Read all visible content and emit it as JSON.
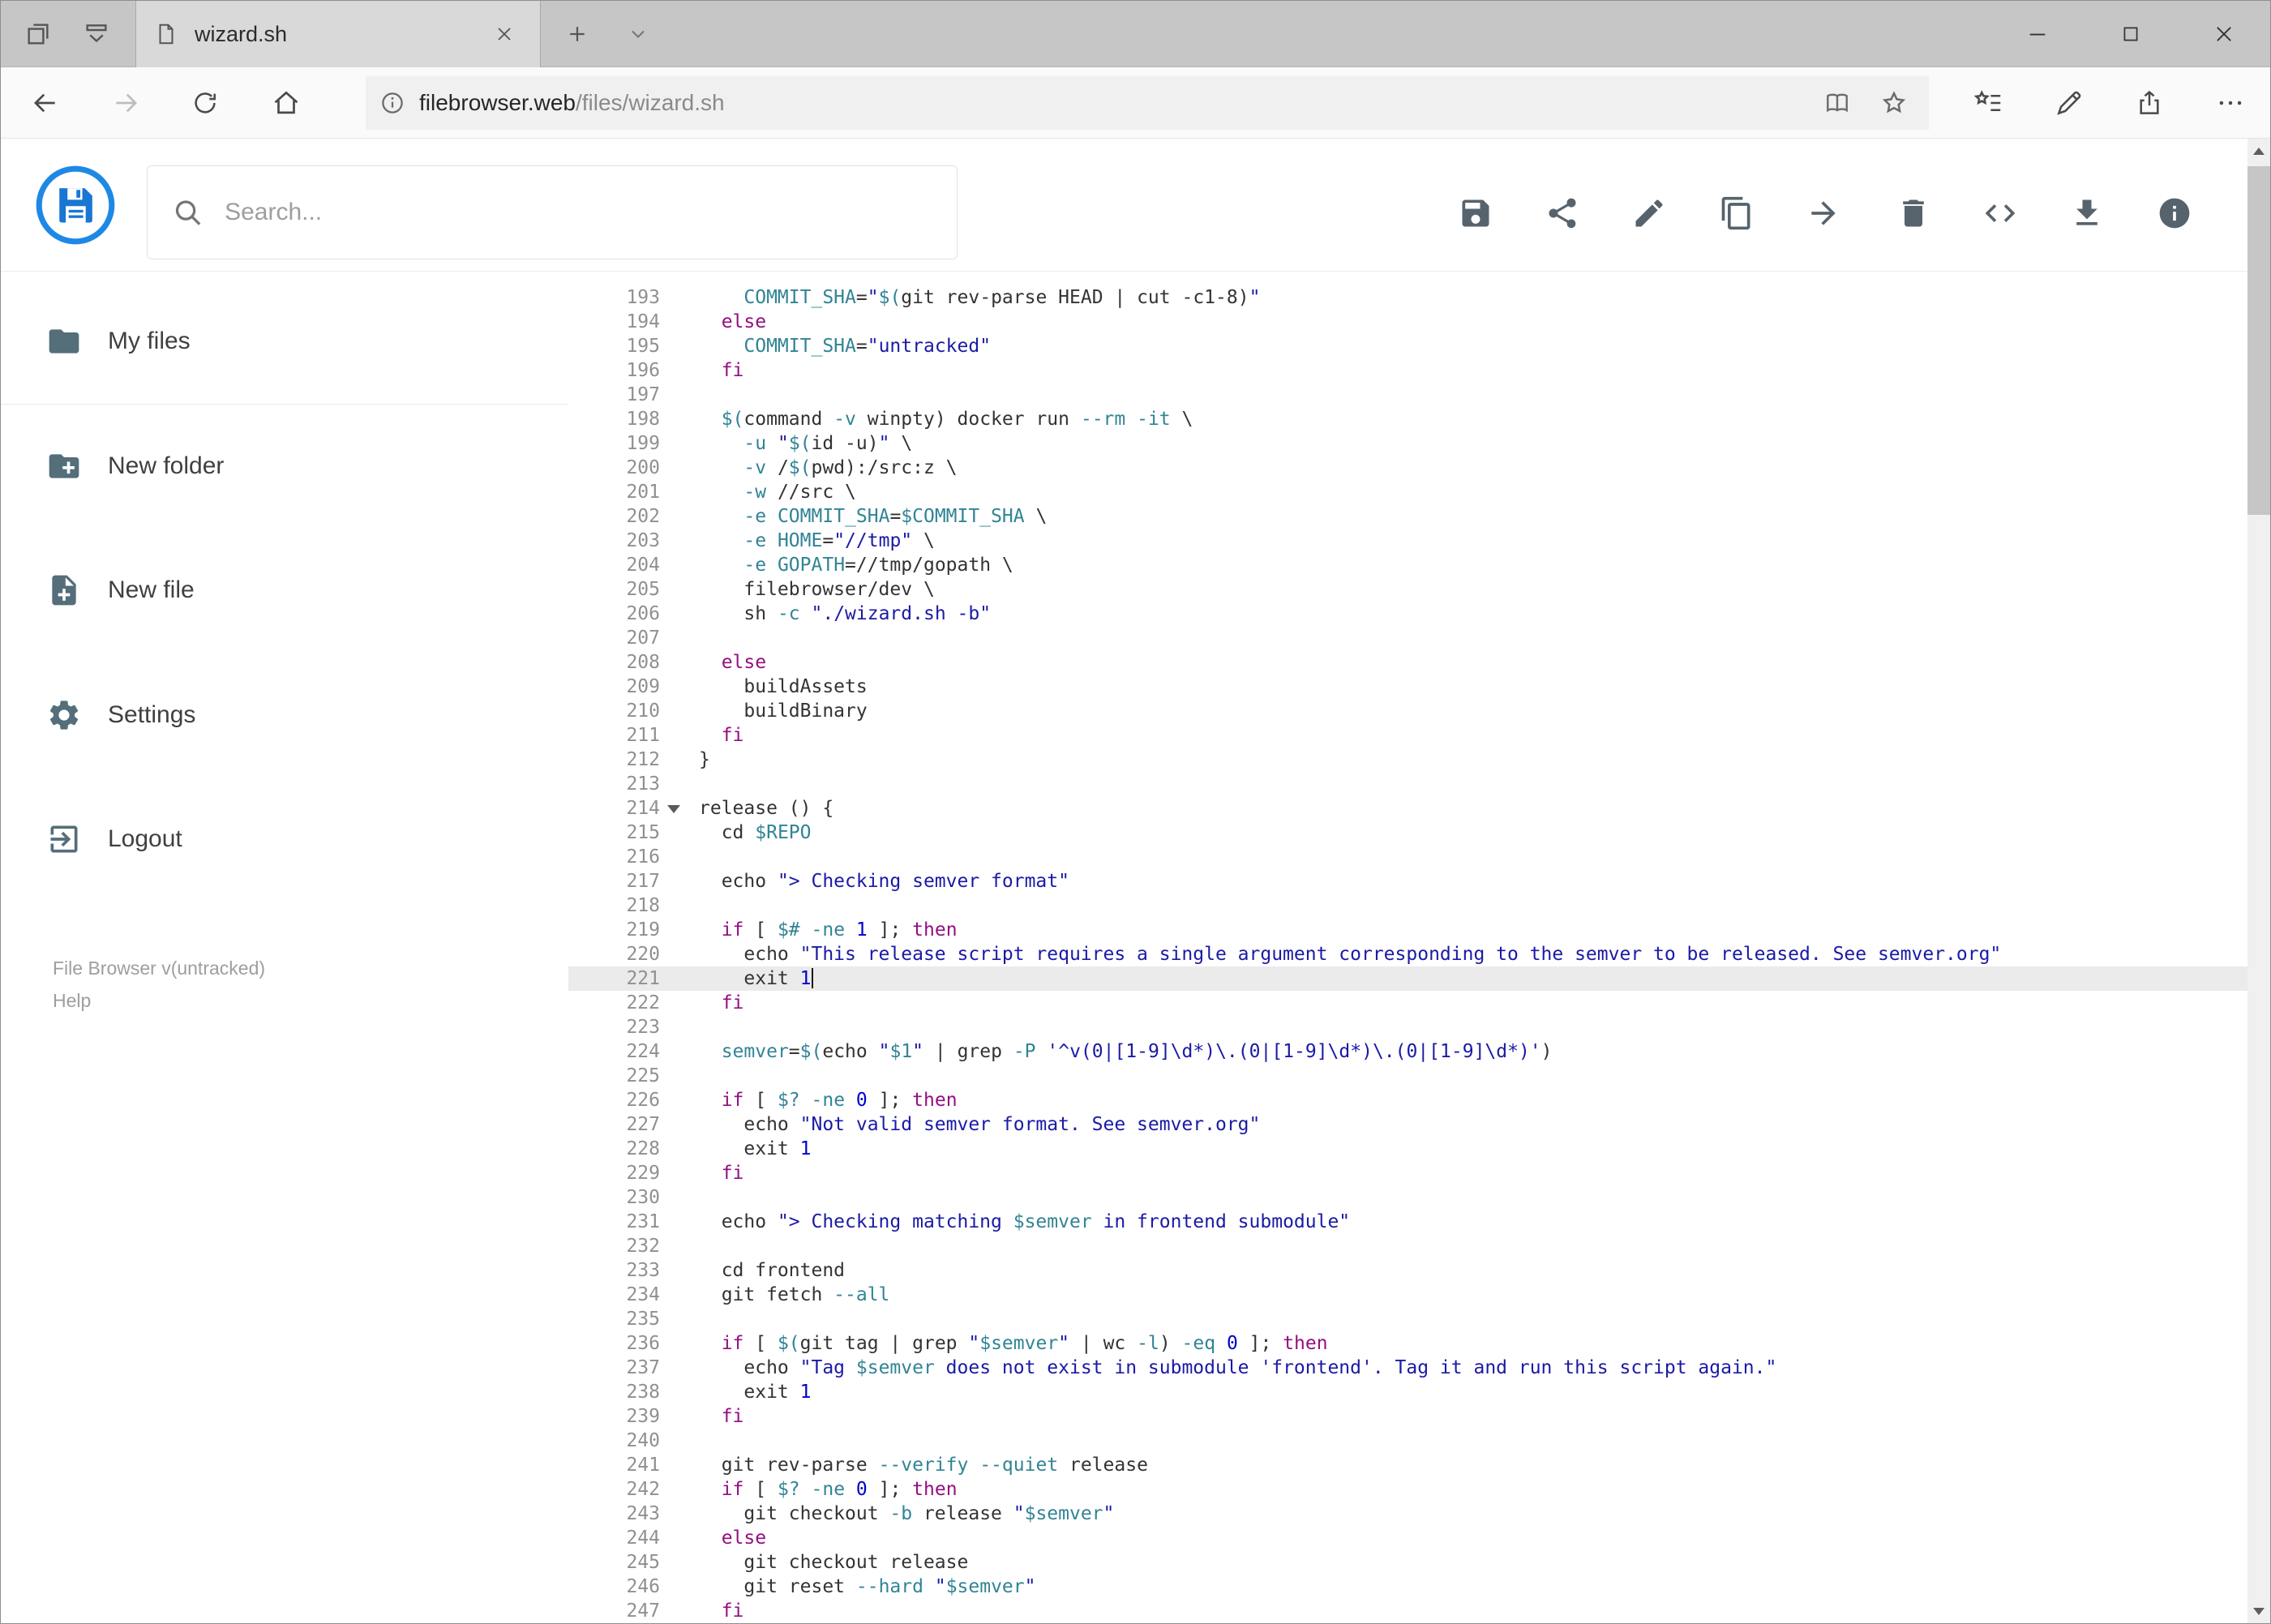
{
  "browser": {
    "tab_title": "wizard.sh",
    "url_domain": "filebrowser.web",
    "url_path": "/files/wizard.sh",
    "chrome_icons": [
      "set-tabs-aside-icon",
      "tab-preview-icon",
      "page-icon",
      "tab-close-icon",
      "new-tab-icon",
      "tab-list-chevron-icon",
      "minimize-icon",
      "maximize-icon",
      "close-icon",
      "back-icon",
      "forward-icon",
      "refresh-icon",
      "home-icon",
      "site-info-icon",
      "reading-view-icon",
      "favorite-star-icon",
      "hub-icon",
      "web-note-pen-icon",
      "share-icon",
      "ellipsis-icon"
    ]
  },
  "header": {
    "search_placeholder": "Search...",
    "action_icons": [
      "save",
      "share",
      "edit",
      "copy",
      "move",
      "delete",
      "code",
      "download",
      "info"
    ],
    "accent_color": "#1e88e5"
  },
  "sidebar": {
    "items": [
      {
        "label": "My files",
        "icon": "folder-icon"
      },
      {
        "label": "New folder",
        "icon": "new-folder-icon"
      },
      {
        "label": "New file",
        "icon": "new-file-icon"
      },
      {
        "label": "Settings",
        "icon": "settings-gear-icon"
      },
      {
        "label": "Logout",
        "icon": "logout-icon"
      }
    ],
    "footer_version": "File Browser v(untracked)",
    "footer_help": "Help"
  },
  "editor": {
    "language": "shell",
    "active_line": 221,
    "fold_line": 214,
    "colors": {
      "keyword": "#930f80",
      "string": "#1a1aa6",
      "variable": "#318495",
      "flag": "#318495",
      "number": "#0000cd",
      "text": "#333333",
      "active_line_bg": "#ebebeb"
    },
    "lines": [
      {
        "n": 193,
        "t": "    COMMIT_SHA=\"$(git rev-parse HEAD | cut -c1-8)\""
      },
      {
        "n": 194,
        "t": "  else"
      },
      {
        "n": 195,
        "t": "    COMMIT_SHA=\"untracked\""
      },
      {
        "n": 196,
        "t": "  fi"
      },
      {
        "n": 197,
        "t": ""
      },
      {
        "n": 198,
        "t": "  $(command -v winpty) docker run --rm -it \\"
      },
      {
        "n": 199,
        "t": "    -u \"$(id -u)\" \\"
      },
      {
        "n": 200,
        "t": "    -v /$(pwd):/src:z \\"
      },
      {
        "n": 201,
        "t": "    -w //src \\"
      },
      {
        "n": 202,
        "t": "    -e COMMIT_SHA=$COMMIT_SHA \\"
      },
      {
        "n": 203,
        "t": "    -e HOME=\"//tmp\" \\"
      },
      {
        "n": 204,
        "t": "    -e GOPATH=//tmp/gopath \\"
      },
      {
        "n": 205,
        "t": "    filebrowser/dev \\"
      },
      {
        "n": 206,
        "t": "    sh -c \"./wizard.sh -b\""
      },
      {
        "n": 207,
        "t": ""
      },
      {
        "n": 208,
        "t": "  else"
      },
      {
        "n": 209,
        "t": "    buildAssets"
      },
      {
        "n": 210,
        "t": "    buildBinary"
      },
      {
        "n": 211,
        "t": "  fi"
      },
      {
        "n": 212,
        "t": "}"
      },
      {
        "n": 213,
        "t": ""
      },
      {
        "n": 214,
        "t": "release () {"
      },
      {
        "n": 215,
        "t": "  cd $REPO"
      },
      {
        "n": 216,
        "t": ""
      },
      {
        "n": 217,
        "t": "  echo \"> Checking semver format\""
      },
      {
        "n": 218,
        "t": ""
      },
      {
        "n": 219,
        "t": "  if [ $# -ne 1 ]; then"
      },
      {
        "n": 220,
        "t": "    echo \"This release script requires a single argument corresponding to the semver to be released. See semver.org\""
      },
      {
        "n": 221,
        "t": "    exit 1"
      },
      {
        "n": 222,
        "t": "  fi"
      },
      {
        "n": 223,
        "t": ""
      },
      {
        "n": 224,
        "t": "  semver=$(echo \"$1\" | grep -P '^v(0|[1-9]\\d*)\\.(0|[1-9]\\d*)\\.(0|[1-9]\\d*)')"
      },
      {
        "n": 225,
        "t": ""
      },
      {
        "n": 226,
        "t": "  if [ $? -ne 0 ]; then"
      },
      {
        "n": 227,
        "t": "    echo \"Not valid semver format. See semver.org\""
      },
      {
        "n": 228,
        "t": "    exit 1"
      },
      {
        "n": 229,
        "t": "  fi"
      },
      {
        "n": 230,
        "t": ""
      },
      {
        "n": 231,
        "t": "  echo \"> Checking matching $semver in frontend submodule\""
      },
      {
        "n": 232,
        "t": ""
      },
      {
        "n": 233,
        "t": "  cd frontend"
      },
      {
        "n": 234,
        "t": "  git fetch --all"
      },
      {
        "n": 235,
        "t": ""
      },
      {
        "n": 236,
        "t": "  if [ $(git tag | grep \"$semver\" | wc -l) -eq 0 ]; then"
      },
      {
        "n": 237,
        "t": "    echo \"Tag $semver does not exist in submodule 'frontend'. Tag it and run this script again.\""
      },
      {
        "n": 238,
        "t": "    exit 1"
      },
      {
        "n": 239,
        "t": "  fi"
      },
      {
        "n": 240,
        "t": ""
      },
      {
        "n": 241,
        "t": "  git rev-parse --verify --quiet release"
      },
      {
        "n": 242,
        "t": "  if [ $? -ne 0 ]; then"
      },
      {
        "n": 243,
        "t": "    git checkout -b release \"$semver\""
      },
      {
        "n": 244,
        "t": "  else"
      },
      {
        "n": 245,
        "t": "    git checkout release"
      },
      {
        "n": 246,
        "t": "    git reset --hard \"$semver\""
      },
      {
        "n": 247,
        "t": "  fi"
      }
    ]
  }
}
